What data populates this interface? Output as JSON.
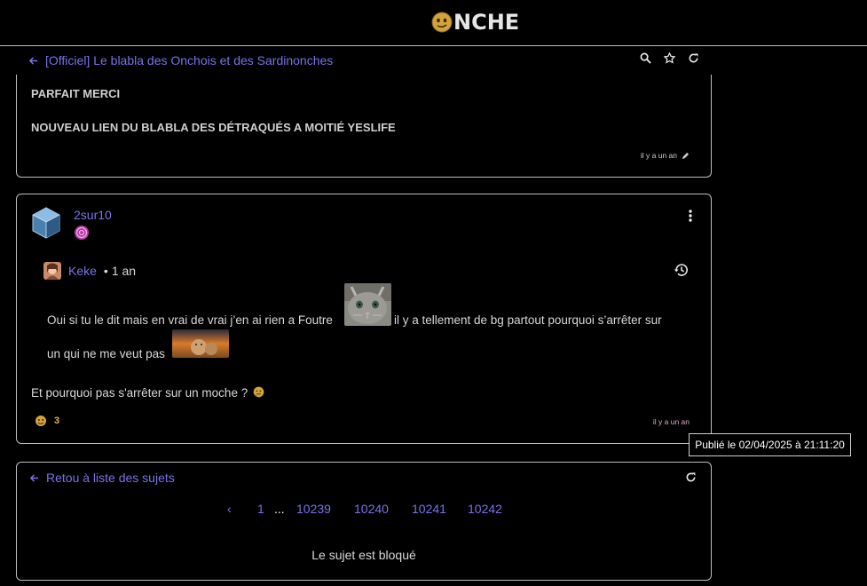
{
  "header": {
    "logo_text": "NCHE"
  },
  "topic": {
    "title": "[Officiel] Le blabla des Onchois et des Sardinonches"
  },
  "post1": {
    "line1": "PARFAIT MERCI",
    "line2": "NOUVEAU LIEN DU BLABLA DES DÉTRAQUÉS A MOITIÉ YESLIFE",
    "time": "il y a un an"
  },
  "post2": {
    "username": "2sur10",
    "quote": {
      "user": "Keke",
      "age": "1 an",
      "text_part1": "Oui si tu le dit mais en vrai de vrai j’en ai rien a Foutre",
      "text_part2": "il y a tellement de bg partout pourquoi s’arrêter sur",
      "text_part3": "un qui ne me veut pas"
    },
    "body": "Et pourquoi pas s'arrêter sur un moche ?",
    "reaction_count": "3",
    "time": "il y a un an"
  },
  "tooltip": "Publié le 02/04/2025 à 21:11:20",
  "footer": {
    "back_label": "Retou à liste des sujets",
    "pages": {
      "prev": "‹",
      "first": "1",
      "ellipsis": "...",
      "p1": "10239",
      "p2": "10240",
      "p3": "10241",
      "p4": "10242"
    },
    "locked_text": "Le sujet est bloqué"
  },
  "colors": {
    "link": "#7b72e8",
    "border": "#bdbdbd",
    "reaction": "#e0b64a"
  },
  "icons": {
    "logo": "onche-face-icon",
    "back": "arrow-left-icon",
    "search": "search-icon",
    "favorite": "star-icon",
    "refresh": "refresh-icon",
    "edit": "pencil-icon",
    "menu": "kebab-icon",
    "history": "history-icon",
    "reaction": "reaction-face-icon"
  }
}
